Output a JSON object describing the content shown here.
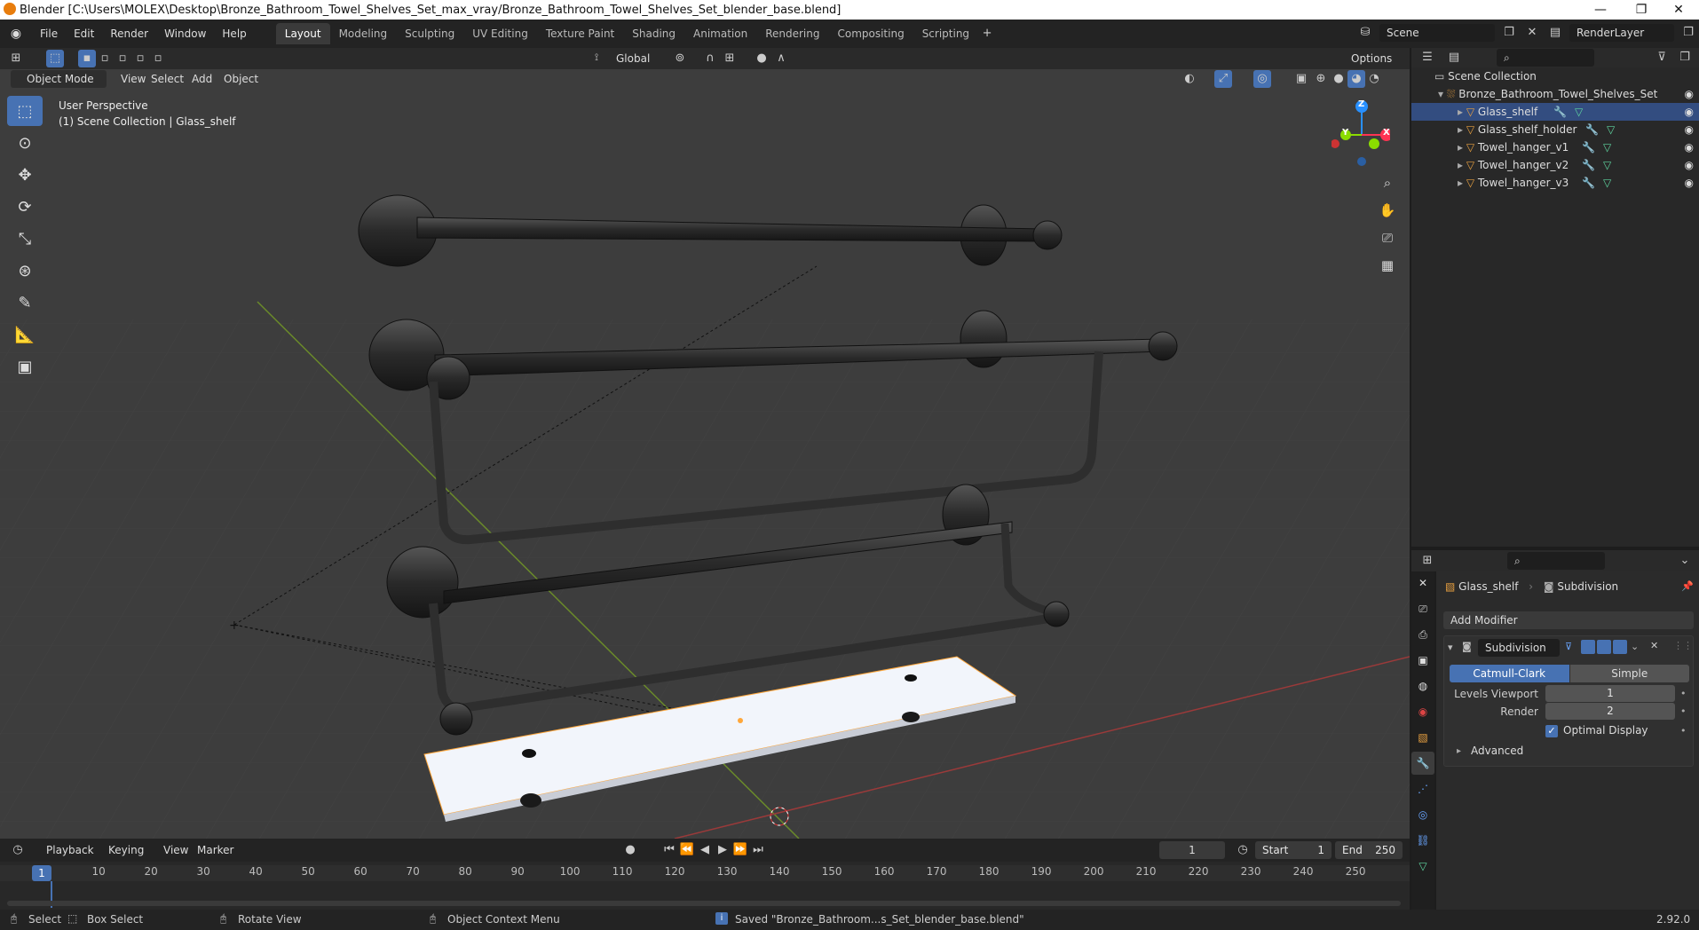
{
  "window": {
    "title": "Blender [C:\\Users\\MOLEX\\Desktop\\Bronze_Bathroom_Towel_Shelves_Set_max_vray/Bronze_Bathroom_Towel_Shelves_Set_blender_base.blend]",
    "minimize": "—",
    "restore": "❐",
    "close": "✕"
  },
  "menu": {
    "items": [
      "File",
      "Edit",
      "Render",
      "Window",
      "Help"
    ]
  },
  "workspaces": [
    "Layout",
    "Modeling",
    "Sculpting",
    "UV Editing",
    "Texture Paint",
    "Shading",
    "Animation",
    "Rendering",
    "Compositing",
    "Scripting"
  ],
  "scene": {
    "name": "Scene",
    "render_layer": "RenderLayer"
  },
  "viewport": {
    "transform_orientation": "Global",
    "options_label": "Options",
    "mode": "Object Mode",
    "menus": [
      "View",
      "Select",
      "Add",
      "Object"
    ],
    "perspective": "User Perspective",
    "collection_info": "(1) Scene Collection | Glass_shelf",
    "gizmo": {
      "z": "Z",
      "y": "Y",
      "x": "X"
    }
  },
  "outliner": {
    "root": "Scene Collection",
    "collection": "Bronze_Bathroom_Towel_Shelves_Set",
    "objects": [
      "Glass_shelf",
      "Glass_shelf_holder",
      "Towel_hanger_v1",
      "Towel_hanger_v2",
      "Towel_hanger_v3"
    ]
  },
  "properties": {
    "object": "Glass_shelf",
    "modifier_crumb": "Subdivision",
    "add_modifier": "Add Modifier",
    "modifier_name": "Subdivision",
    "tabs": [
      "Catmull-Clark",
      "Simple"
    ],
    "levels_label": "Levels Viewport",
    "levels_value": "1",
    "render_label": "Render",
    "render_value": "2",
    "optimal_display": "Optimal Display",
    "advanced": "Advanced"
  },
  "timeline": {
    "menus": [
      "Playback",
      "Keying",
      "View",
      "Marker"
    ],
    "current_frame": "1",
    "start_label": "Start",
    "start_value": "1",
    "end_label": "End",
    "end_value": "250",
    "ticks": [
      "1",
      "10",
      "20",
      "30",
      "40",
      "50",
      "60",
      "70",
      "80",
      "90",
      "100",
      "110",
      "120",
      "130",
      "140",
      "150",
      "160",
      "170",
      "180",
      "190",
      "200",
      "210",
      "220",
      "230",
      "240",
      "250"
    ]
  },
  "status": {
    "select": "Select",
    "box_select": "Box Select",
    "rotate_view": "Rotate View",
    "context_menu": "Object Context Menu",
    "message": "Saved \"Bronze_Bathroom...s_Set_blender_base.blend\"",
    "version": "2.92.0"
  },
  "colors": {
    "accent": "#4772b3",
    "x_axis": "#ff3352",
    "y_axis": "#8bdc00",
    "z_axis": "#2890ff"
  }
}
